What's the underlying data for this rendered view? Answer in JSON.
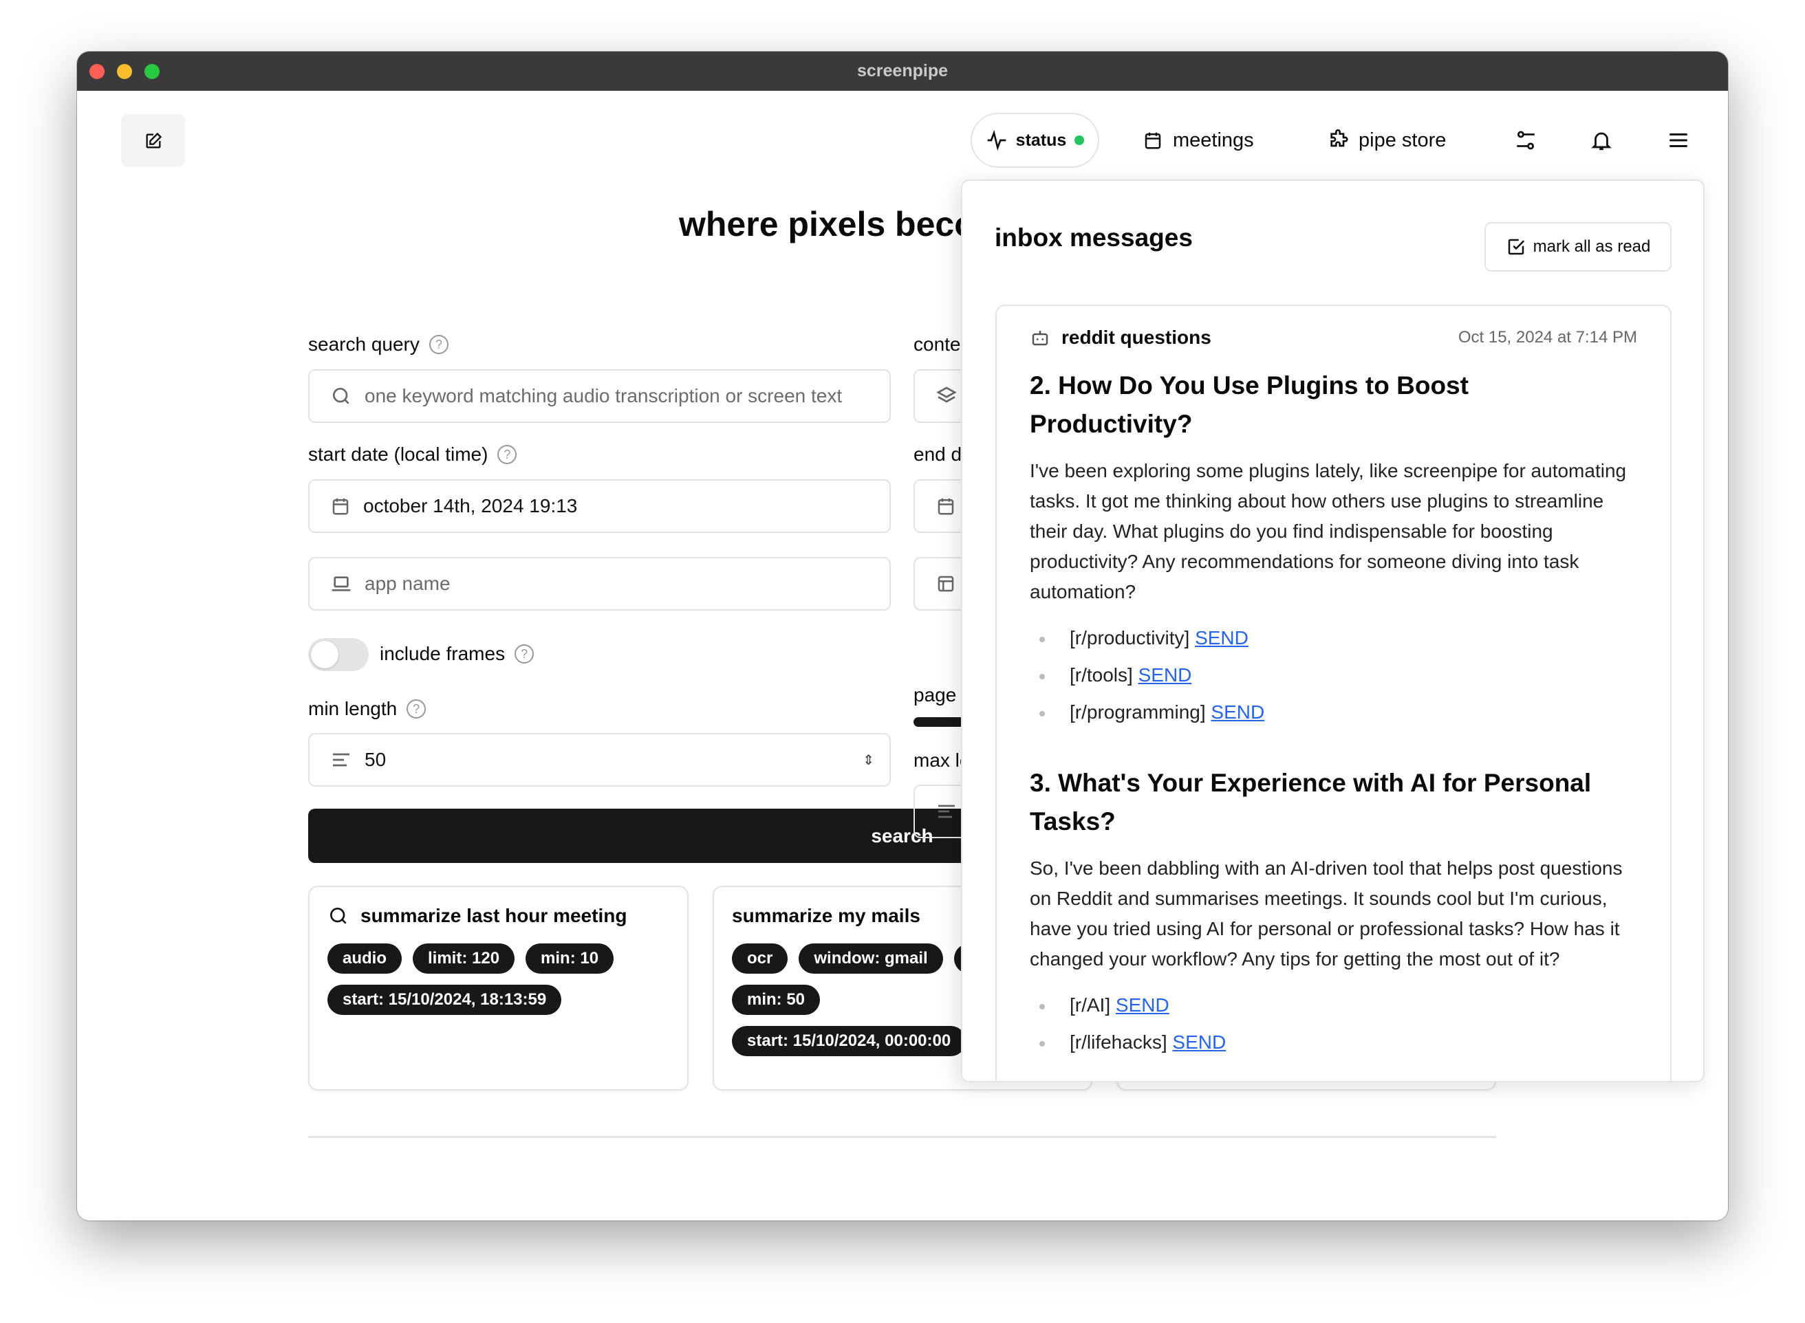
{
  "window": {
    "title": "screenpipe",
    "traffic_lights": [
      "#ff5f57",
      "#febc2e",
      "#28c840"
    ]
  },
  "header": {
    "status": "status",
    "status_color": "#22c55e",
    "meetings": "meetings",
    "pipe_store": "pipe store"
  },
  "main": {
    "heading": "where pixels become magic",
    "search_query_label": "search query",
    "search_placeholder": "one keyword matching audio transcription or screen text",
    "content_type_label": "content type",
    "start_date_label": "start date (local time)",
    "start_date_value": "october 14th, 2024 19:13",
    "end_date_label": "end date (local time)",
    "app_name_placeholder": "app name",
    "include_frames_label": "include frames",
    "include_frames_on": false,
    "page_size_label": "page size",
    "min_length_label": "min length",
    "min_length_value": "50",
    "max_length_label": "max length",
    "search_button": "search"
  },
  "suggestions": [
    {
      "title": "summarize last hour meeting",
      "chips": [
        "audio",
        "limit: 120",
        "min: 10",
        "start: 15/10/2024, 18:13:59"
      ]
    },
    {
      "title": "summarize my mails",
      "chips": [
        "ocr",
        "window: gmail",
        "",
        "min: 50",
        "start: 15/10/2024, 00:00:00"
      ]
    }
  ],
  "inbox": {
    "title": "inbox messages",
    "mark_all": "mark all as read",
    "message": {
      "sender": "reddit questions",
      "date": "Oct 15, 2024 at 7:14 PM",
      "q1_title": "2. How Do You Use Plugins to Boost Productivity?",
      "q1_body": "I've been exploring some plugins lately, like screenpipe for automating tasks. It got me thinking about how others use plugins to streamline their day. What plugins do you find indispensable for boosting productivity? Any recommendations for someone diving into task automation?",
      "q1_links": [
        {
          "sub": "[r/productivity]",
          "link": "SEND"
        },
        {
          "sub": "[r/tools]",
          "link": "SEND"
        },
        {
          "sub": "[r/programming]",
          "link": "SEND"
        }
      ],
      "q2_title": "3. What's Your Experience with AI for Personal Tasks?",
      "q2_body": "So, I've been dabbling with an AI-driven tool that helps post questions on Reddit and summarises meetings. It sounds cool but I'm curious, have you tried using AI for personal or professional tasks? How has it changed your workflow? Any tips for getting the most out of it?",
      "q2_links": [
        {
          "sub": "[r/AI]",
          "link": "SEND"
        },
        {
          "sub": "[r/lifehacks]",
          "link": "SEND"
        }
      ]
    }
  }
}
